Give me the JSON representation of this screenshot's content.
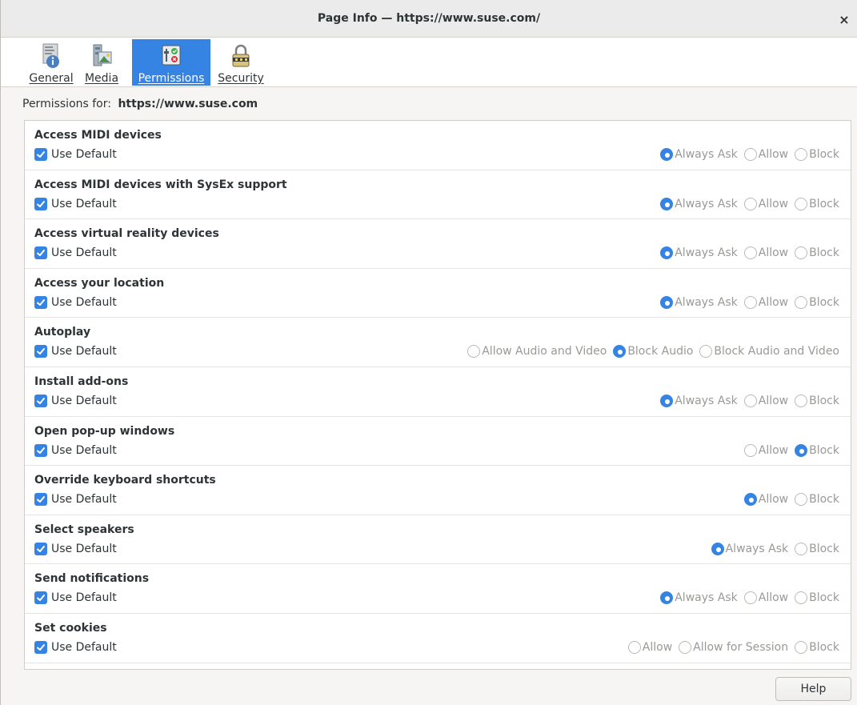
{
  "window": {
    "title": "Page Info — https://www.suse.com/",
    "close_glyph": "×"
  },
  "tabs": [
    {
      "label": "General",
      "icon": "info-document-icon",
      "active": false
    },
    {
      "label": "Media",
      "icon": "media-images-icon",
      "active": false
    },
    {
      "label": "Permissions",
      "icon": "permissions-sliders-icon",
      "active": true
    },
    {
      "label": "Security",
      "icon": "padlock-icon",
      "active": false
    }
  ],
  "permissions_for": {
    "label": "Permissions for:",
    "url": "https://www.suse.com"
  },
  "permissions": [
    {
      "title": "Access MIDI devices",
      "use_default": "Use Default",
      "options": [
        "Always Ask",
        "Allow",
        "Block"
      ],
      "selected": "Always Ask"
    },
    {
      "title": "Access MIDI devices with SysEx support",
      "use_default": "Use Default",
      "options": [
        "Always Ask",
        "Allow",
        "Block"
      ],
      "selected": "Always Ask"
    },
    {
      "title": "Access virtual reality devices",
      "use_default": "Use Default",
      "options": [
        "Always Ask",
        "Allow",
        "Block"
      ],
      "selected": "Always Ask"
    },
    {
      "title": "Access your location",
      "use_default": "Use Default",
      "options": [
        "Always Ask",
        "Allow",
        "Block"
      ],
      "selected": "Always Ask"
    },
    {
      "title": "Autoplay",
      "use_default": "Use Default",
      "options": [
        "Allow Audio and Video",
        "Block Audio",
        "Block Audio and Video"
      ],
      "selected": "Block Audio"
    },
    {
      "title": "Install add-ons",
      "use_default": "Use Default",
      "options": [
        "Always Ask",
        "Allow",
        "Block"
      ],
      "selected": "Always Ask"
    },
    {
      "title": "Open pop-up windows",
      "use_default": "Use Default",
      "options": [
        "Allow",
        "Block"
      ],
      "selected": "Block"
    },
    {
      "title": "Override keyboard shortcuts",
      "use_default": "Use Default",
      "options": [
        "Allow",
        "Block"
      ],
      "selected": "Allow"
    },
    {
      "title": "Select speakers",
      "use_default": "Use Default",
      "options": [
        "Always Ask",
        "Block"
      ],
      "selected": "Always Ask"
    },
    {
      "title": "Send notifications",
      "use_default": "Use Default",
      "options": [
        "Always Ask",
        "Allow",
        "Block"
      ],
      "selected": "Always Ask"
    },
    {
      "title": "Set cookies",
      "use_default": "Use Default",
      "options": [
        "Allow",
        "Allow for Session",
        "Block"
      ],
      "selected": null
    }
  ],
  "footer": {
    "help_label": "Help"
  },
  "colors": {
    "accent": "#3584e4",
    "window_bg": "#f6f5f4",
    "text": "#2e3436",
    "disabled_text": "#9a9996"
  }
}
